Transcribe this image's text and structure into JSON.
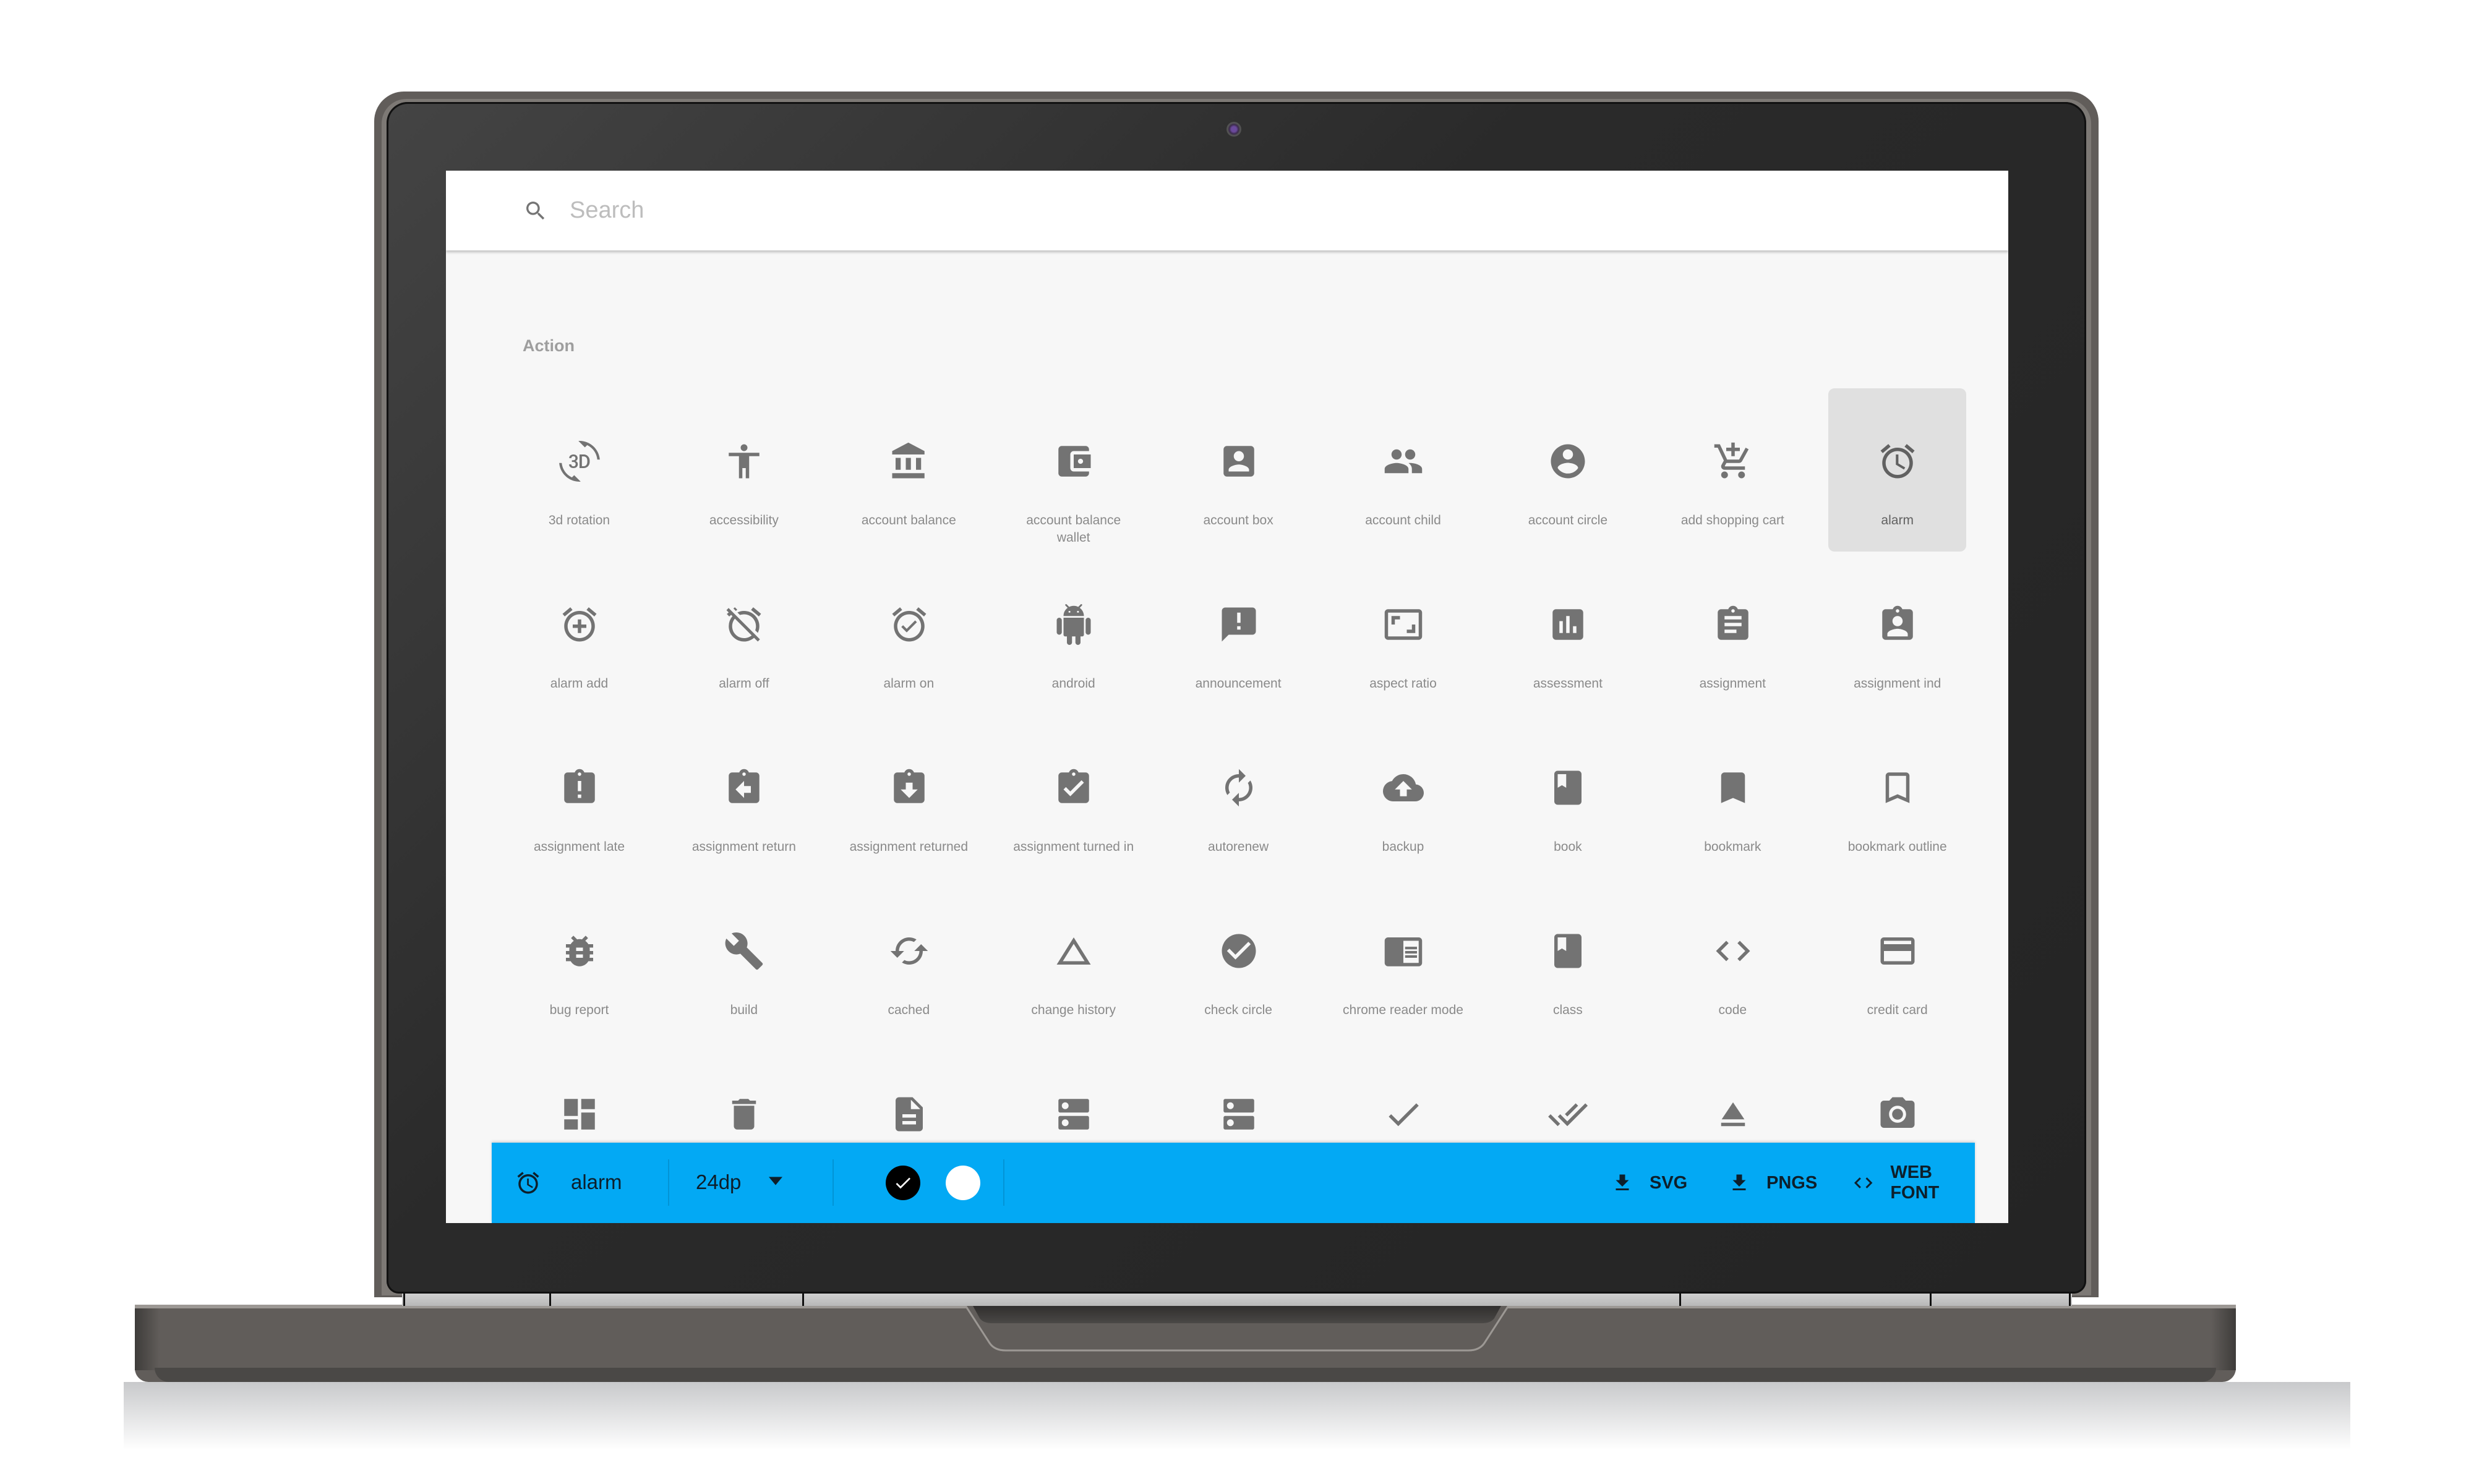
{
  "search": {
    "placeholder": "Search",
    "value": ""
  },
  "section": {
    "title": "Action"
  },
  "icons": [
    {
      "name": "3d rotation",
      "icon": "3d-rotation-icon"
    },
    {
      "name": "accessibility",
      "icon": "accessibility-icon"
    },
    {
      "name": "account balance",
      "icon": "account-balance-icon"
    },
    {
      "name": "account balance wallet",
      "icon": "account-balance-wallet-icon"
    },
    {
      "name": "account box",
      "icon": "account-box-icon"
    },
    {
      "name": "account child",
      "icon": "account-child-icon"
    },
    {
      "name": "account circle",
      "icon": "account-circle-icon"
    },
    {
      "name": "add shopping cart",
      "icon": "add-shopping-cart-icon"
    },
    {
      "name": "alarm",
      "icon": "alarm-icon",
      "selected": true
    },
    {
      "name": "alarm add",
      "icon": "alarm-add-icon"
    },
    {
      "name": "alarm off",
      "icon": "alarm-off-icon"
    },
    {
      "name": "alarm on",
      "icon": "alarm-on-icon"
    },
    {
      "name": "android",
      "icon": "android-icon"
    },
    {
      "name": "announcement",
      "icon": "announcement-icon"
    },
    {
      "name": "aspect ratio",
      "icon": "aspect-ratio-icon"
    },
    {
      "name": "assessment",
      "icon": "assessment-icon"
    },
    {
      "name": "assignment",
      "icon": "assignment-icon"
    },
    {
      "name": "assignment ind",
      "icon": "assignment-ind-icon"
    },
    {
      "name": "assignment late",
      "icon": "assignment-late-icon"
    },
    {
      "name": "assignment return",
      "icon": "assignment-return-icon"
    },
    {
      "name": "assignment returned",
      "icon": "assignment-returned-icon"
    },
    {
      "name": "assignment turned in",
      "icon": "assignment-turned-in-icon"
    },
    {
      "name": "autorenew",
      "icon": "autorenew-icon"
    },
    {
      "name": "backup",
      "icon": "backup-icon"
    },
    {
      "name": "book",
      "icon": "book-icon"
    },
    {
      "name": "bookmark",
      "icon": "bookmark-icon"
    },
    {
      "name": "bookmark outline",
      "icon": "bookmark-outline-icon"
    },
    {
      "name": "bug report",
      "icon": "bug-report-icon"
    },
    {
      "name": "build",
      "icon": "build-icon"
    },
    {
      "name": "cached",
      "icon": "cached-icon"
    },
    {
      "name": "change history",
      "icon": "change-history-icon"
    },
    {
      "name": "check circle",
      "icon": "check-circle-icon"
    },
    {
      "name": "chrome reader mode",
      "icon": "chrome-reader-mode-icon"
    },
    {
      "name": "class",
      "icon": "class-icon"
    },
    {
      "name": "code",
      "icon": "code-icon"
    },
    {
      "name": "credit card",
      "icon": "credit-card-icon"
    },
    {
      "name": "",
      "icon": "dashboard-icon"
    },
    {
      "name": "",
      "icon": "delete-icon"
    },
    {
      "name": "",
      "icon": "description-icon"
    },
    {
      "name": "",
      "icon": "dns-icon"
    },
    {
      "name": "",
      "icon": "dns-server-icon"
    },
    {
      "name": "",
      "icon": "done-icon"
    },
    {
      "name": "",
      "icon": "done-all-icon"
    },
    {
      "name": "",
      "icon": "eject-icon"
    },
    {
      "name": "",
      "icon": "camera-icon"
    }
  ],
  "toolbar": {
    "selected_icon": "alarm-icon",
    "selected_name": "alarm",
    "size": "24dp",
    "colors": {
      "dark": "#000000",
      "light": "#ffffff",
      "selected": "dark"
    },
    "buttons": [
      {
        "label": "SVG",
        "icon": "download-icon"
      },
      {
        "label": "PNGS",
        "icon": "download-icon"
      },
      {
        "label": "WEB FONT",
        "icon": "code-icon"
      }
    ],
    "accent": "#03a9f4"
  }
}
